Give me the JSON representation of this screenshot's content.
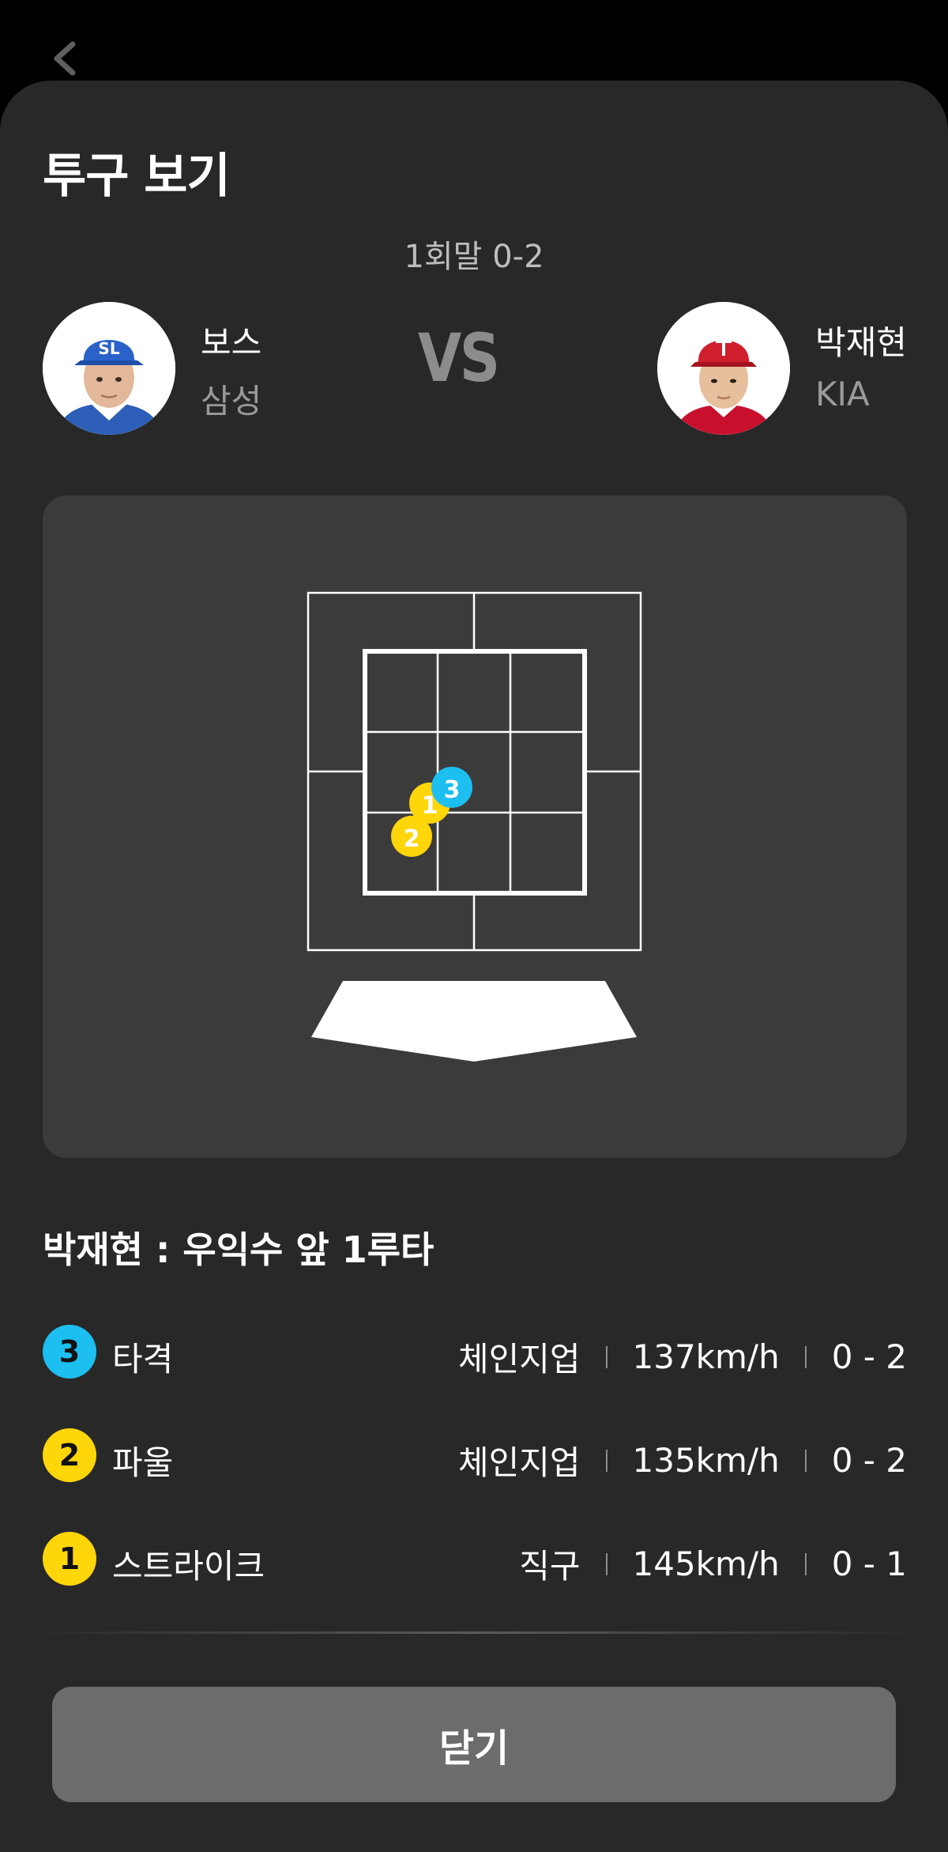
{
  "header": {
    "title": "투구 보기",
    "inning": "1회말 0-2"
  },
  "pitcher": {
    "name": "보스",
    "team": "삼성"
  },
  "vs_label": "VS",
  "batter": {
    "name": "박재현",
    "team": "KIA"
  },
  "result_text": "박재현 : 우익수 앞 1루타",
  "zone_markers": [
    {
      "number": "1",
      "color": "#FFD60A"
    },
    {
      "number": "2",
      "color": "#FFD60A"
    },
    {
      "number": "3",
      "color": "#1DBEF0"
    }
  ],
  "pitches": [
    {
      "number": "3",
      "color": "#1DBEF0",
      "result": "타격",
      "type": "체인지업",
      "speed": "137km/h",
      "count": "0 - 2"
    },
    {
      "number": "2",
      "color": "#FFD60A",
      "result": "파울",
      "type": "체인지업",
      "speed": "135km/h",
      "count": "0 - 2"
    },
    {
      "number": "1",
      "color": "#FFD60A",
      "result": "스트라이크",
      "type": "직구",
      "speed": "145km/h",
      "count": "0 - 1"
    }
  ],
  "close_label": "닫기"
}
